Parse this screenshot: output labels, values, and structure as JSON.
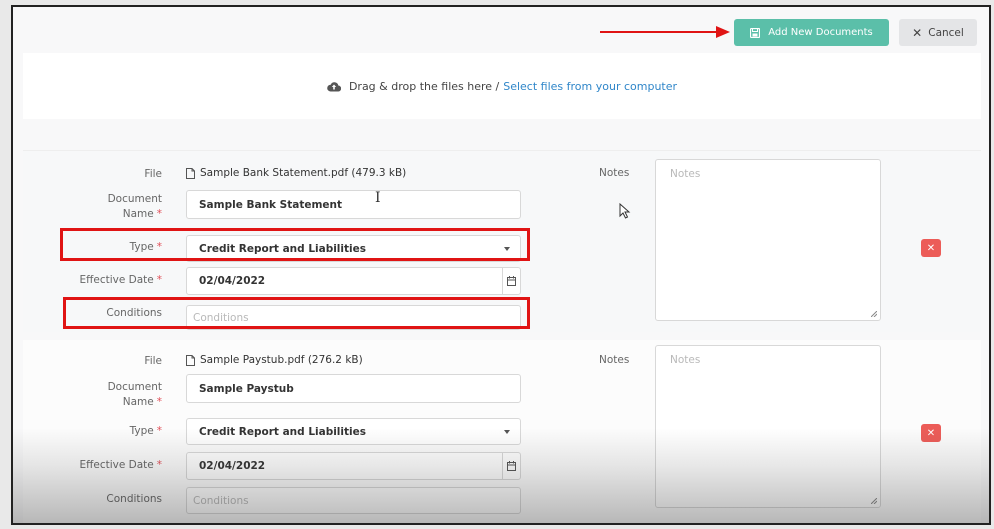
{
  "toolbar": {
    "add_label": "Add New Documents",
    "cancel_label": "Cancel"
  },
  "dropzone": {
    "text": "Drag & drop the files here /",
    "link": "Select files from your computer"
  },
  "labels": {
    "file": "File",
    "document_name_line1": "Document",
    "document_name_line2": "Name",
    "type": "Type",
    "effective_date": "Effective Date",
    "conditions": "Conditions",
    "notes": "Notes",
    "required_mark": "*"
  },
  "documents": [
    {
      "file": "Sample Bank Statement.pdf (479.3 kB)",
      "document_name": "Sample Bank Statement",
      "type": "Credit Report and Liabilities",
      "effective_date": "02/04/2022",
      "conditions_placeholder": "Conditions",
      "notes_placeholder": "Notes"
    },
    {
      "file": "Sample Paystub.pdf (276.2 kB)",
      "document_name": "Sample Paystub",
      "type": "Credit Report and Liabilities",
      "effective_date": "02/04/2022",
      "conditions_placeholder": "Conditions",
      "notes_placeholder": "Notes"
    }
  ],
  "colors": {
    "accent": "#5bbfa9",
    "danger": "#ec5c58",
    "annotation": "#e01414",
    "link": "#2f86c9"
  },
  "icons": [
    "save-icon",
    "close-icon",
    "cloud-upload-icon",
    "file-icon",
    "calendar-icon",
    "caret-down-icon",
    "delete-icon",
    "red-arrow-annotation"
  ]
}
